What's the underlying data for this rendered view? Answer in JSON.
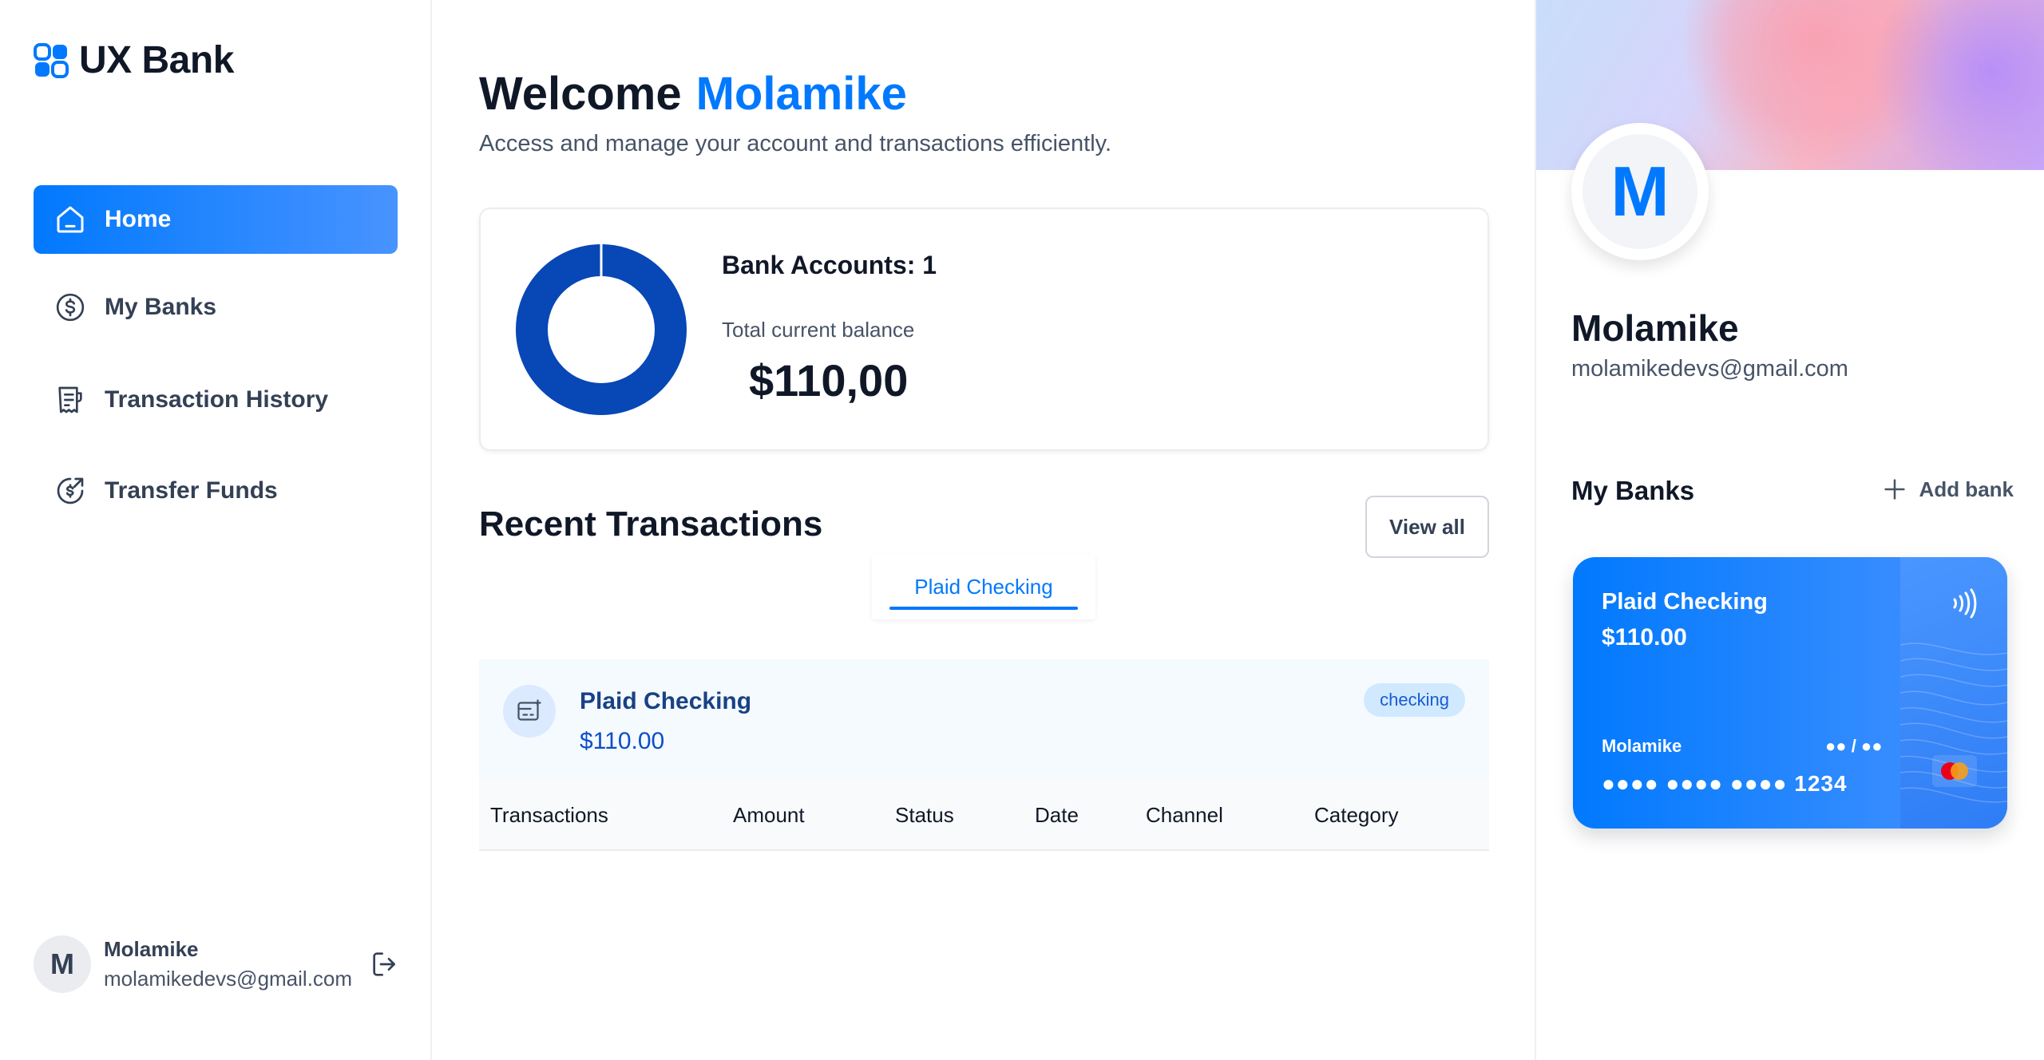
{
  "app": {
    "name": "UX Bank",
    "brand_color": "#0179fe"
  },
  "sidebar": {
    "items": [
      {
        "label": "Home",
        "icon": "home-icon",
        "active": true
      },
      {
        "label": "My Banks",
        "icon": "dollar-circle-icon",
        "active": false
      },
      {
        "label": "Transaction History",
        "icon": "receipt-icon",
        "active": false
      },
      {
        "label": "Transfer Funds",
        "icon": "money-send-icon",
        "active": false
      }
    ],
    "footer": {
      "avatar_initial": "M",
      "name": "Molamike",
      "email": "molamikedevs@gmail.com",
      "logout_icon": "logout-icon"
    }
  },
  "header": {
    "greeting": "Welcome",
    "user": "Molamike",
    "subtitle": "Access and manage your account and transactions efficiently."
  },
  "balance": {
    "accounts_label": "Bank Accounts: 1",
    "total_label": "Total current balance",
    "total_value": "$110,00"
  },
  "recent": {
    "title": "Recent Transactions",
    "view_all": "View all",
    "tabs": [
      {
        "label": "Plaid Checking",
        "active": true
      }
    ],
    "bank": {
      "name": "Plaid Checking",
      "amount": "$110.00",
      "badge": "checking"
    },
    "columns": [
      "Transactions",
      "Amount",
      "Status",
      "Date",
      "Channel",
      "Category"
    ]
  },
  "right_sidebar": {
    "avatar_initial": "M",
    "name": "Molamike",
    "email": "molamikedevs@gmail.com",
    "my_banks_title": "My Banks",
    "add_bank_label": "Add bank",
    "card": {
      "title": "Plaid Checking",
      "amount": "$110.00",
      "holder": "Molamike",
      "expiry": "●● / ●●",
      "number": "●●●● ●●●● ●●●● 1234"
    }
  }
}
